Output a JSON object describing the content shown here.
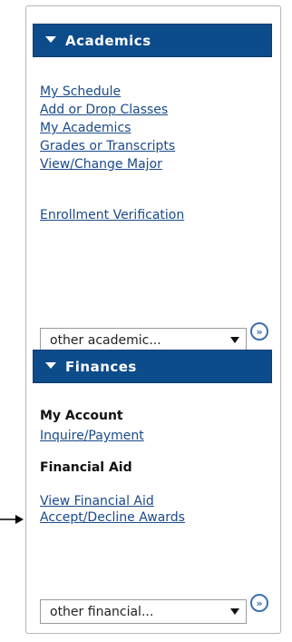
{
  "academics": {
    "title": "Academics",
    "links": [
      "My Schedule",
      "Add or Drop Classes",
      "My Academics",
      "Grades or Transcripts",
      "View/Change Major",
      "Enrollment Verification"
    ],
    "select_value": "other academic..."
  },
  "finances": {
    "title": "Finances",
    "account_heading": "My Account",
    "account_link": "Inquire/Payment",
    "aid_heading": "Financial Aid",
    "aid_links": [
      "View Financial Aid",
      "Accept/Decline Awards"
    ],
    "select_value": "other financial..."
  },
  "colors": {
    "header_bg": "#0d4c8b",
    "link": "#1a4a8a",
    "go_button": "#3d6fb0"
  }
}
